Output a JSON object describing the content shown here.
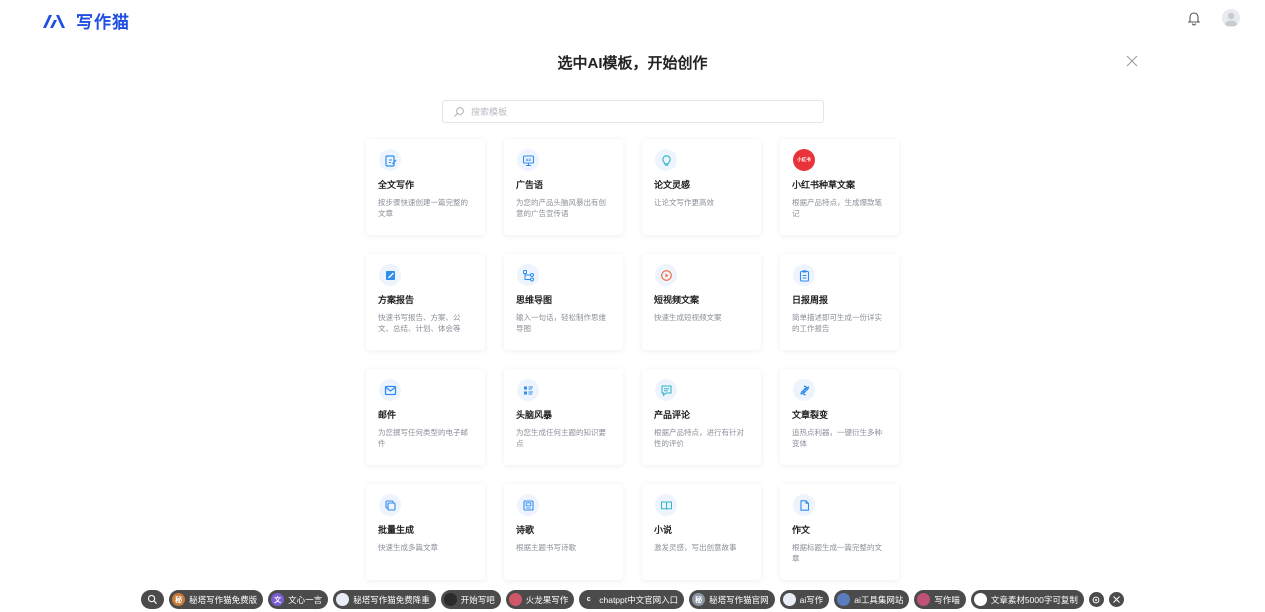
{
  "header": {
    "logo_text": "写作猫",
    "brand_color": "#1f4fe0"
  },
  "main": {
    "title": "选中AI模板，开始创作",
    "search_placeholder": "搜索模板"
  },
  "templates": [
    {
      "title": "全文写作",
      "desc": "按步骤快速创建一篇完整的文章",
      "icon": "pencil-doc-icon"
    },
    {
      "title": "广告语",
      "desc": "为您的产品头脑风暴出有创意的广告宣传语",
      "icon": "ad-icon"
    },
    {
      "title": "论文灵感",
      "desc": "让论文写作更高效",
      "icon": "lightbulb-icon"
    },
    {
      "title": "小红书种草文案",
      "desc": "根据产品特点，生成爆款笔记",
      "icon": "xiaohongshu-icon",
      "icon_text": "小红书"
    },
    {
      "title": "方案报告",
      "desc": "快速书写报告、方案、公文、总结、计划、体会等",
      "icon": "report-icon"
    },
    {
      "title": "思维导图",
      "desc": "输入一句话，轻松制作思维导图",
      "icon": "mindmap-icon"
    },
    {
      "title": "短视频文案",
      "desc": "快速生成短视频文案",
      "icon": "video-icon"
    },
    {
      "title": "日报周报",
      "desc": "简单描述即可生成一份详实的工作报告",
      "icon": "clipboard-icon"
    },
    {
      "title": "邮件",
      "desc": "为您撰写任何类型的电子邮件",
      "icon": "mail-icon"
    },
    {
      "title": "头脑风暴",
      "desc": "为您生成任何主题的知识要点",
      "icon": "brainstorm-icon"
    },
    {
      "title": "产品评论",
      "desc": "根据产品特点，进行有针对性的评价",
      "icon": "comment-icon"
    },
    {
      "title": "文章裂变",
      "desc": "追热点利器，一键衍生多种变体",
      "icon": "fission-icon"
    },
    {
      "title": "批量生成",
      "desc": "快速生成多篇文章",
      "icon": "batch-icon"
    },
    {
      "title": "诗歌",
      "desc": "根据主题书写诗歌",
      "icon": "poem-icon"
    },
    {
      "title": "小说",
      "desc": "激发灵感，写出创意故事",
      "icon": "book-icon"
    },
    {
      "title": "作文",
      "desc": "根据标题生成一篇完整的文章",
      "icon": "essay-icon"
    }
  ],
  "taskbar": {
    "items": [
      {
        "label": "秘塔写作猫免费版",
        "dot": "秘",
        "color": "#c97b3a"
      },
      {
        "label": "文心一言",
        "dot": "文",
        "color": "#7b5fd0"
      },
      {
        "label": "秘塔写作猫免费降重",
        "dot": "",
        "color": "#e9eef6"
      },
      {
        "label": "开始写吧",
        "dot": "",
        "color": "#2b2b2b"
      },
      {
        "label": "火龙果写作",
        "dot": "",
        "color": "#d2566a"
      },
      {
        "label": "chatppt中文官网入口",
        "dot": "c",
        "color": "#4b4b4b"
      },
      {
        "label": "秘塔写作猫官网",
        "dot": "秘",
        "color": "#8d96a5"
      },
      {
        "label": "ai写作",
        "dot": "",
        "color": "#e9eef6"
      },
      {
        "label": "ai工具集网站",
        "dot": "",
        "color": "#5c7cc0"
      },
      {
        "label": "写作喵",
        "dot": "",
        "color": "#c05277"
      },
      {
        "label": "文章素材5000字可复制",
        "dot": "",
        "color": "#ffffff"
      }
    ]
  }
}
